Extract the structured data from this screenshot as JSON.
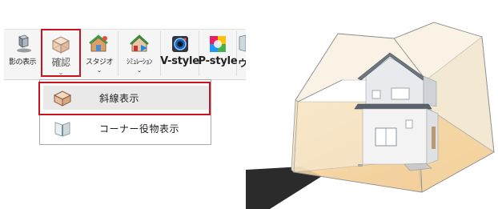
{
  "toolbar": {
    "items": [
      {
        "label": "影の表示",
        "icon": "shadow-display-icon"
      },
      {
        "label": "確認",
        "icon": "confirm-box-icon",
        "has_dropdown": true
      },
      {
        "label": "スタジオ",
        "icon": "studio-icon",
        "has_dropdown": true
      },
      {
        "label": "ｼﾐｭﾚｰｼｮﾝ",
        "icon": "simulation-icon",
        "has_dropdown": true
      },
      {
        "label": "V-style",
        "icon": "camera-icon"
      },
      {
        "label": "P-style",
        "icon": "photo-icon"
      },
      {
        "label": "ウ",
        "icon": "partial-icon"
      }
    ],
    "dropdown_arrow": "⌄"
  },
  "menu": {
    "items": [
      {
        "label": "斜線表示",
        "icon": "slope-line-icon",
        "selected": true
      },
      {
        "label": "コーナー役物表示",
        "icon": "corner-trim-icon",
        "selected": false
      }
    ]
  },
  "colors": {
    "highlight": "#c8141e",
    "envelope_fill": "#f6ead0",
    "ground": "#f3c98a"
  }
}
